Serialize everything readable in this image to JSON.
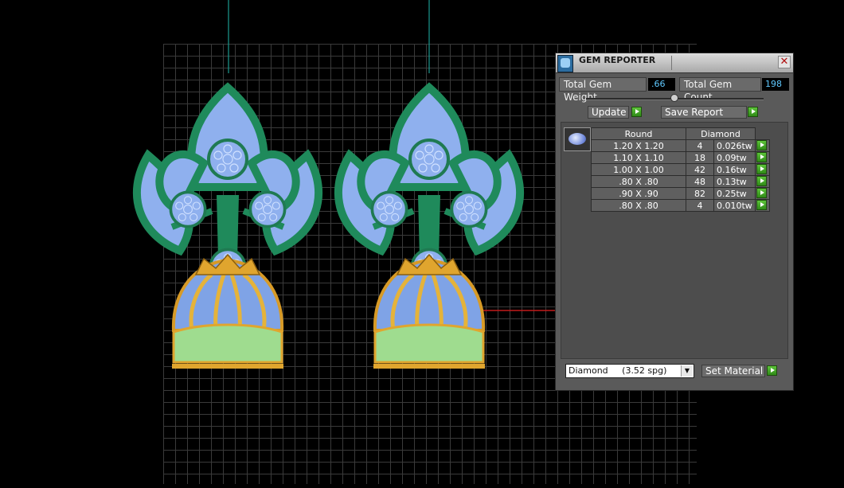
{
  "panel": {
    "title": "GEM REPORTER",
    "close_label": "✕",
    "total_gem_weight_label": "Total Gem Weight",
    "total_gem_weight_value": ".66",
    "total_gem_count_label": "Total Gem Count",
    "total_gem_count_value": "198",
    "update_label": "Update",
    "save_report_label": "Save Report",
    "table": {
      "headers": [
        "Round",
        "Diamond"
      ],
      "rows": [
        {
          "size": "1.20 X 1.20",
          "count": "4",
          "weight": "0.026tw"
        },
        {
          "size": "1.10 X 1.10",
          "count": "18",
          "weight": "0.09tw"
        },
        {
          "size": "1.00 X 1.00",
          "count": "42",
          "weight": "0.16tw"
        },
        {
          "size": ".80 X .80",
          "count": "48",
          "weight": "0.13tw"
        },
        {
          "size": ".90 X .90",
          "count": "82",
          "weight": "0.25tw"
        },
        {
          "size": ".80 X .80",
          "count": "4",
          "weight": "0.010tw"
        }
      ]
    },
    "material_value": "Diamond     (3.52 spg)",
    "set_material_label": "Set Material"
  },
  "icons": {
    "title": "gem-reporter-icon",
    "gem_shape": "oval-gem-icon",
    "play": "green-arrow-icon",
    "close": "close-icon",
    "dropdown": "chevron-down-icon"
  },
  "colors": {
    "metal_green": "#1f8a5b",
    "gem_blue": "#8fb0ee",
    "gold": "#e0a52e",
    "base_green": "#9fdc8f",
    "value_cyan": "#5fc9ff",
    "accent_green": "#3aa51f"
  }
}
